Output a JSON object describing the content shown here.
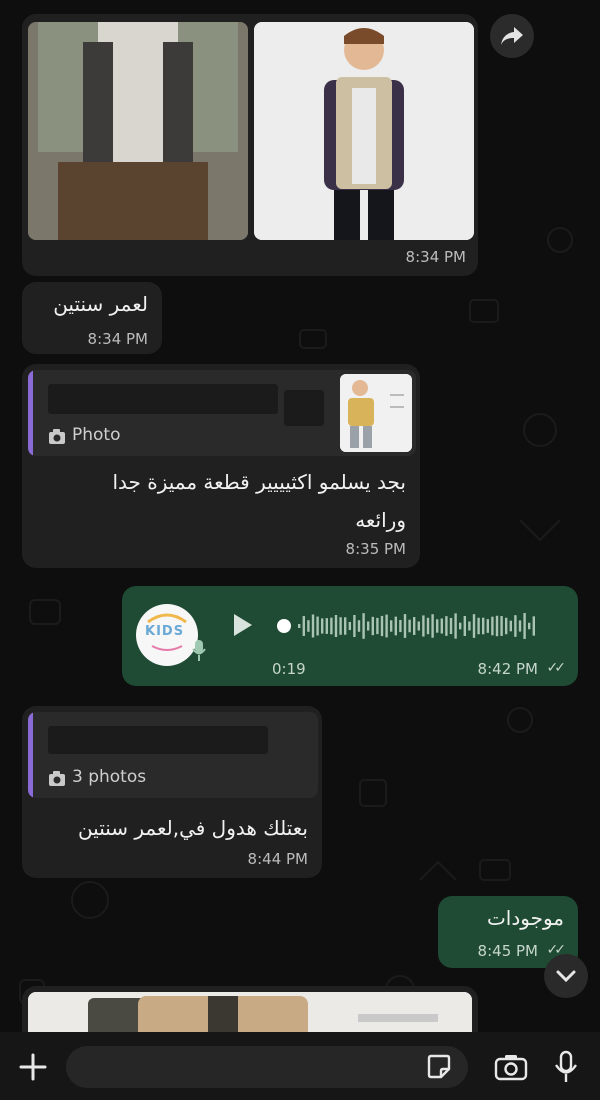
{
  "messages": [
    {
      "id": "album1",
      "time": "8:34 PM"
    },
    {
      "id": "m1",
      "text": "لعمر سنتين",
      "time": "8:34 PM"
    },
    {
      "id": "m2",
      "quote_label": "Photo",
      "text_line1": "بجد يسلمو اكثيييير قطعة مميزة جدا",
      "text_line2": "ورائعه",
      "time": "8:35 PM"
    },
    {
      "id": "voice",
      "duration": "0:19",
      "time": "8:42 PM",
      "logo_text": "KIDS"
    },
    {
      "id": "m3",
      "quote_label": "3 photos",
      "text": "بعتلك هدول في,لعمر سنتين",
      "time": "8:44 PM"
    },
    {
      "id": "m4",
      "text": "موجودات",
      "time": "8:45 PM"
    }
  ],
  "colors": {
    "outgoing": "#1f4a33",
    "incoming": "#202020",
    "accent": "#8a6bd6"
  },
  "icons": [
    "forward-icon",
    "camera-icon",
    "play-icon",
    "mic-icon",
    "chevron-down-icon",
    "plus-icon",
    "sticker-icon"
  ]
}
